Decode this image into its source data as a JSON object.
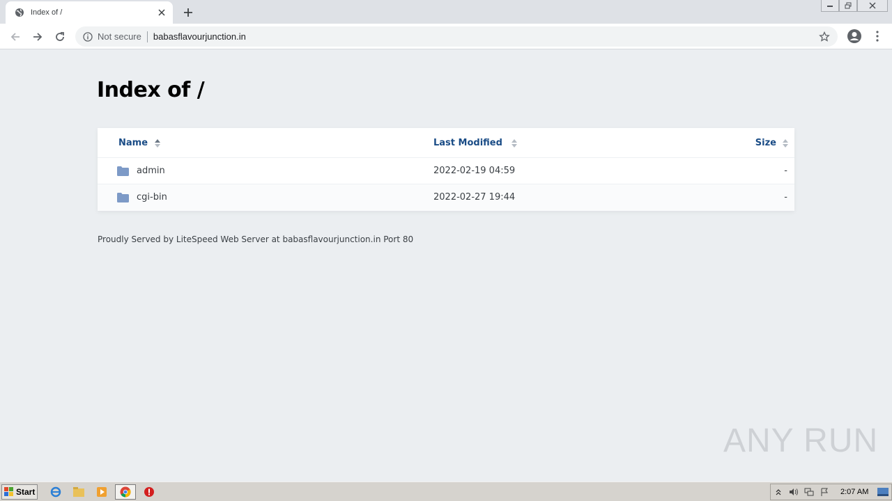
{
  "browser": {
    "tab_title": "Index of /",
    "security_label": "Not secure",
    "url": "babasflavourjunction.in"
  },
  "page": {
    "title": "Index of /",
    "columns": {
      "name": "Name",
      "modified": "Last Modified",
      "size": "Size"
    },
    "rows": [
      {
        "name": "admin",
        "modified": "2022-02-19 04:59",
        "size": "-"
      },
      {
        "name": "cgi-bin",
        "modified": "2022-02-27 19:44",
        "size": "-"
      }
    ],
    "footer": "Proudly Served by LiteSpeed Web Server at babasflavourjunction.in Port 80"
  },
  "watermark": "ANY RUN",
  "taskbar": {
    "start_label": "Start",
    "clock": "2:07 AM"
  },
  "colors": {
    "link": "#1a4c86",
    "folder": "#7d9ac7"
  }
}
